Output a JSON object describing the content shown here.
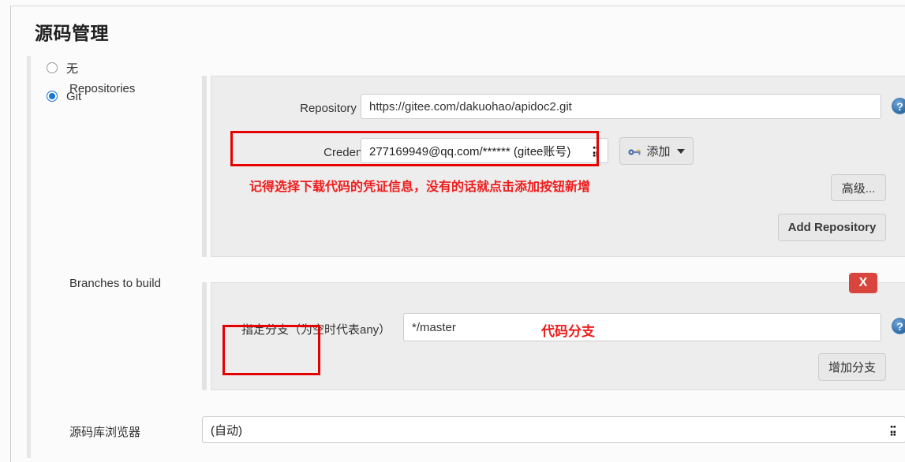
{
  "page": {
    "title": "源码管理"
  },
  "scm": {
    "options": [
      {
        "label": "无",
        "checked": false
      },
      {
        "label": "Git",
        "checked": true
      }
    ]
  },
  "repositories": {
    "label": "Repositories",
    "repository_url": {
      "label": "Repository URL",
      "value": "https://gitee.com/dakuohao/apidoc2.git",
      "help_icon": "help-icon"
    },
    "credentials": {
      "label": "Credentials",
      "value": "277169949@qq.com/****** (gitee账号)",
      "chevron": "chevron-down-icon"
    },
    "add_button": {
      "label": "添加",
      "icon": "key-icon",
      "caret": "caret-down-icon"
    },
    "advanced_button": "高级...",
    "add_repository_button": "Add Repository",
    "annotation": "记得选择下载代码的凭证信息，没有的话就点击添加按钮新增"
  },
  "branches": {
    "label": "Branches to build",
    "branch_specifier": {
      "label": "指定分支（为空时代表any）",
      "value": "*/master",
      "help_icon": "help-icon"
    },
    "annotation": "代码分支",
    "remove_button": "X",
    "add_branch_button": "增加分支"
  },
  "repository_browser": {
    "label": "源码库浏览器",
    "value": "(自动)",
    "chevron": "chevron-down-icon"
  },
  "colors": {
    "accent_blue": "#1577d6",
    "annotation_red": "#ee1c1c",
    "danger_red": "#d9453c",
    "panel_gray": "#ededed"
  }
}
